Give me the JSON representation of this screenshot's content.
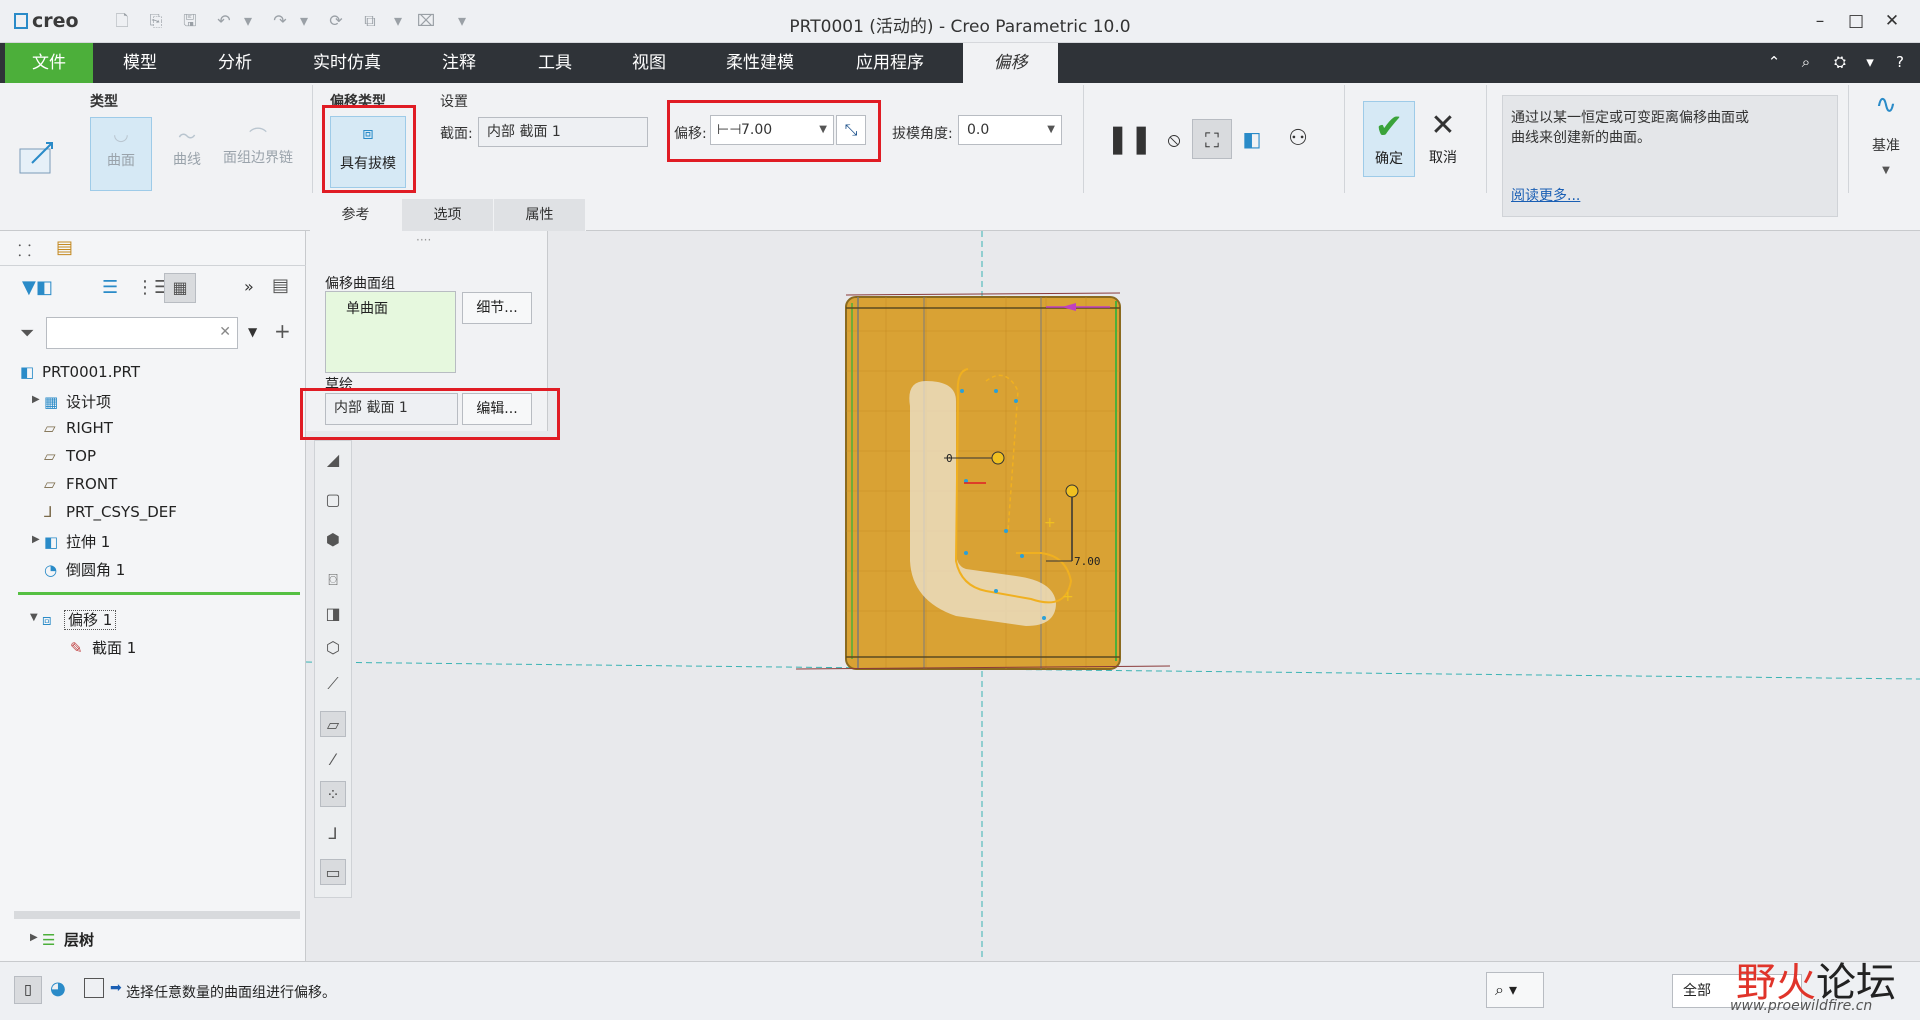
{
  "window": {
    "logo": "creo",
    "title": "PRT0001 (活动的) - Creo Parametric 10.0",
    "controls": [
      "–",
      "□",
      "✕"
    ]
  },
  "menu": {
    "tabs": [
      "文件",
      "模型",
      "分析",
      "实时仿真",
      "注释",
      "工具",
      "视图",
      "柔性建模",
      "应用程序",
      "偏移"
    ],
    "active": "偏移"
  },
  "ribbon": {
    "type_group": {
      "label": "类型",
      "items": [
        "曲面",
        "曲线",
        "面组边界链"
      ]
    },
    "offset_type": {
      "label": "偏移类型",
      "button": "具有拔模"
    },
    "settings": {
      "label": "设置",
      "section_label": "截面:",
      "section_value": "内部 截面 1",
      "offset_label": "偏移:",
      "offset_value": "7.00",
      "draft_label": "拔模角度:",
      "draft_value": "0.0"
    },
    "ok_label": "确定",
    "cancel_label": "取消",
    "help_text": "通过以某一恒定或可变距离偏移曲面或曲线来创建新的曲面。",
    "help_link": "阅读更多...",
    "datum_label": "基准",
    "subtabs": [
      "参考",
      "选项",
      "属性"
    ]
  },
  "ref_panel": {
    "collection_label": "偏移曲面组",
    "collection_item": "单曲面",
    "details_button": "细节...",
    "sketch_label": "草绘",
    "sketch_value": "内部 截面 1",
    "edit_button": "编辑..."
  },
  "model_tree": {
    "items": [
      {
        "label": "PRT0001.PRT",
        "icon": "part-icon"
      },
      {
        "label": "设计项",
        "icon": "design-items-icon"
      },
      {
        "label": "RIGHT",
        "icon": "datum-plane-icon"
      },
      {
        "label": "TOP",
        "icon": "datum-plane-icon"
      },
      {
        "label": "FRONT",
        "icon": "datum-plane-icon"
      },
      {
        "label": "PRT_CSYS_DEF",
        "icon": "csys-icon"
      },
      {
        "label": "拉伸 1",
        "icon": "extrude-icon"
      },
      {
        "label": "倒圆角 1",
        "icon": "round-icon"
      },
      {
        "label": "偏移 1",
        "icon": "offset-icon"
      },
      {
        "label": "截面 1",
        "icon": "sketch-icon"
      }
    ],
    "layer_tree": "层树"
  },
  "graphics": {
    "dimension_value": "7.00",
    "dimension_zero": "0"
  },
  "status": {
    "message": "选择任意数量的曲面组进行偏移。",
    "filter_value": "全部"
  },
  "watermark": {
    "brand_a": "野火",
    "brand_b": "论坛",
    "url": "www.proewildfire.cn"
  },
  "colors": {
    "file_tab": "#4caf3a",
    "selection": "#d6e9f5",
    "highlight_box": "#e01c24",
    "model_fill": "#d9a234"
  }
}
